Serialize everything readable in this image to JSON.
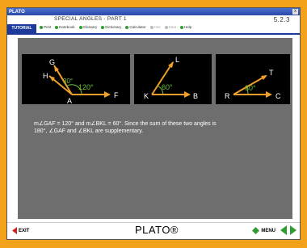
{
  "window": {
    "title": "PLATO",
    "close_glyph": "x"
  },
  "header": {
    "mode_badge": "TUTORIAL",
    "lesson_title": "SPECIAL ANGLES - PART 1",
    "page_number": "5.2.3",
    "menu": [
      {
        "label": "Print",
        "enabled": true
      },
      {
        "label": "Notebook",
        "enabled": true
      },
      {
        "label": "Glossary",
        "enabled": true
      },
      {
        "label": "Dictionary",
        "enabled": true
      },
      {
        "label": "Calculator",
        "enabled": true
      },
      {
        "label": "Hint",
        "enabled": false
      },
      {
        "label": "Data",
        "enabled": false
      },
      {
        "label": "Help",
        "enabled": true
      }
    ]
  },
  "diagrams": [
    {
      "angle_name": "GAF",
      "angle_label": "120°",
      "ray_points": [
        "G",
        "H"
      ],
      "vertex": "A",
      "side_point": "F"
    },
    {
      "angle_name": "BKL",
      "angle_label": "60°",
      "ray_points": [
        "L"
      ],
      "vertex": "K",
      "side_point": "B"
    },
    {
      "angle_name": "CRT",
      "angle_label": "30°",
      "ray_points": [
        "T"
      ],
      "vertex": "R",
      "side_point": "C"
    }
  ],
  "explanation": {
    "line1": "m∠GAF = 120° and m∠BKL = 60°. Since the sum of these two angles is",
    "line2": "180°, ∠GAF and ∠BKL are supplementary."
  },
  "footer": {
    "exit_label": "EXIT",
    "brand": "PLATO®",
    "menu_label": "MENU"
  },
  "colors": {
    "background": "#f2a21a",
    "header_blue": "#1d3a9a",
    "content_gray": "#6e6e6e",
    "arrow_orange": "#f0a02a",
    "arc_green": "#6fbf3a",
    "nav_green": "#2e9e2e",
    "exit_red": "#d02020"
  }
}
